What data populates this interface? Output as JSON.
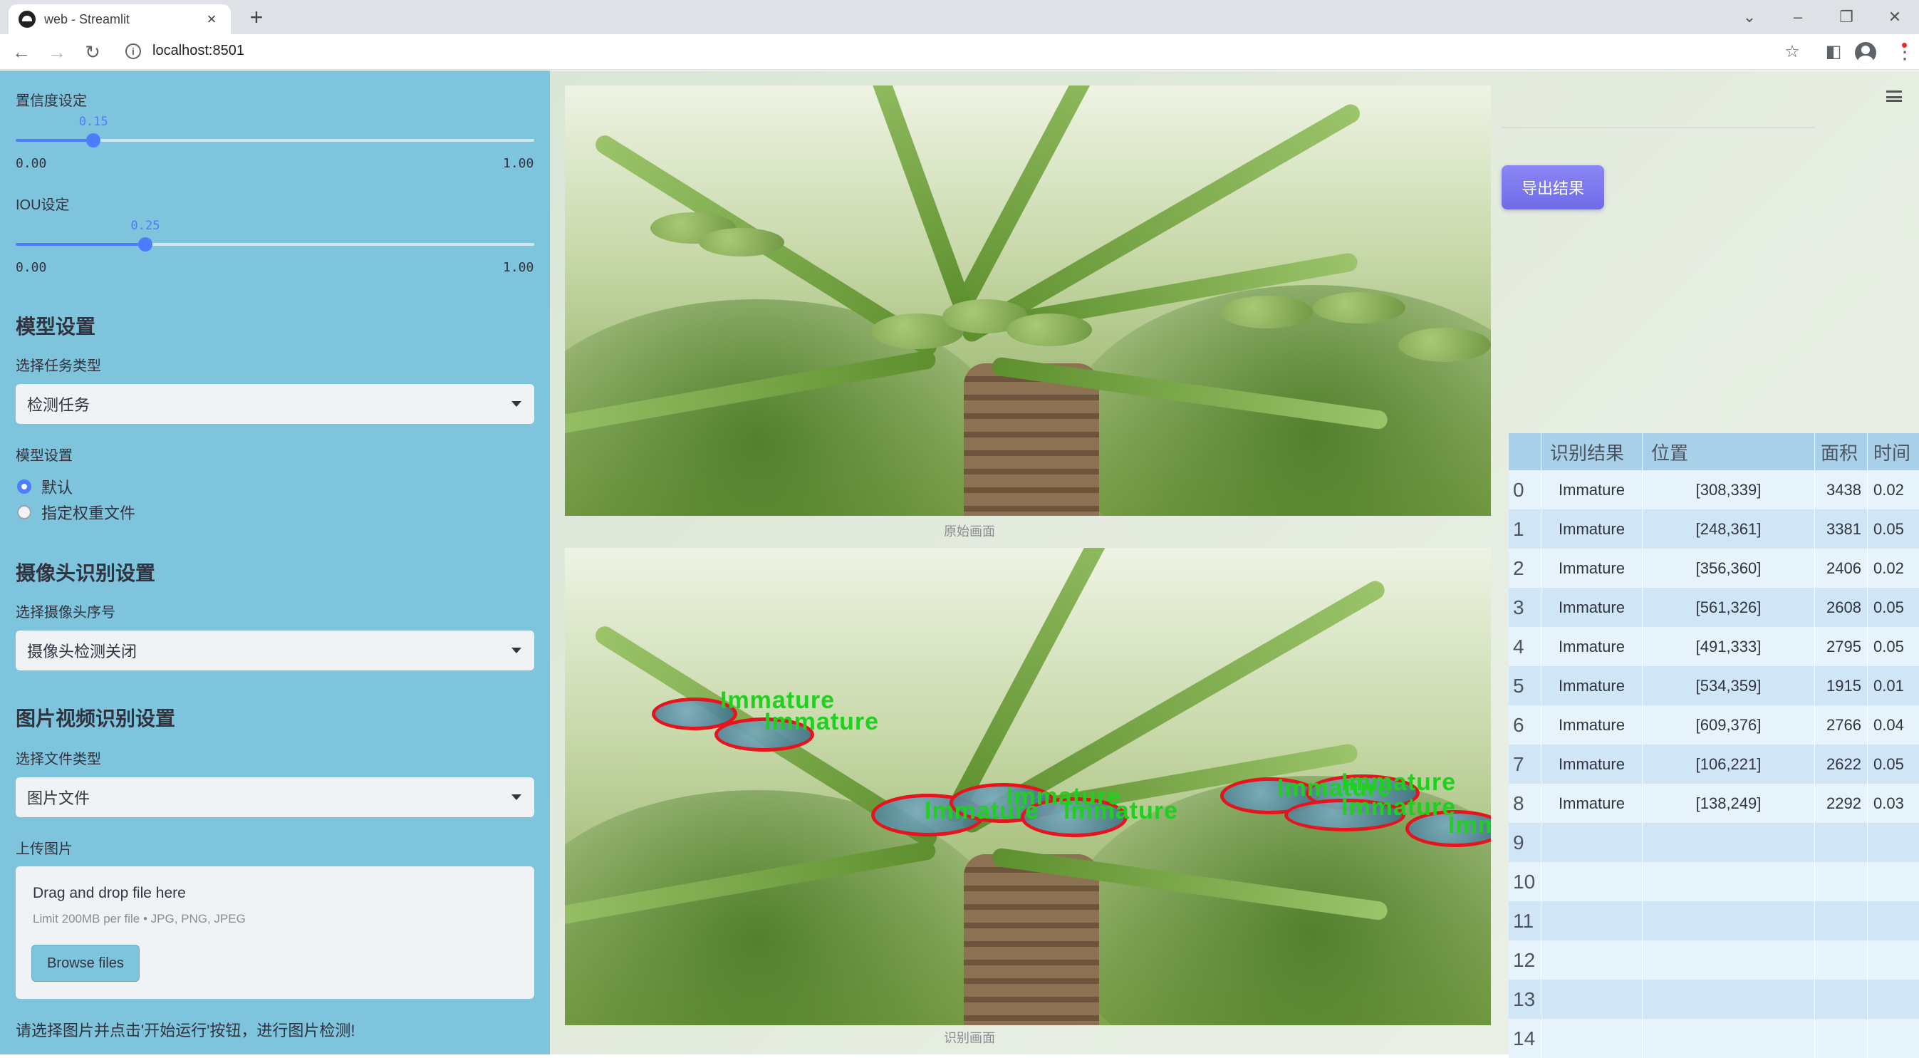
{
  "browser": {
    "tab_title": "web - Streamlit",
    "url": "localhost:8501"
  },
  "sidebar": {
    "conf_label": "置信度设定",
    "conf": {
      "value": "0.15",
      "min": "0.00",
      "max": "1.00",
      "fraction": 0.15
    },
    "iou_label": "IOU设定",
    "iou": {
      "value": "0.25",
      "min": "0.00",
      "max": "1.00",
      "fraction": 0.25
    },
    "model_heading": "模型设置",
    "task_type_label": "选择任务类型",
    "task_type_value": "检测任务",
    "model_label": "模型设置",
    "model_options": [
      "默认",
      "指定权重文件"
    ],
    "model_selected": 0,
    "camera_heading": "摄像头识别设置",
    "camera_label": "选择摄像头序号",
    "camera_value": "摄像头检测关闭",
    "media_heading": "图片视频识别设置",
    "file_type_label": "选择文件类型",
    "file_type_value": "图片文件",
    "upload_label": "上传图片",
    "upload": {
      "title": "Drag and drop file here",
      "limit": "Limit 200MB per file • JPG, PNG, JPEG",
      "button": "Browse files"
    },
    "info_text": "请选择图片并点击'开始运行'按钮，进行图片检测!"
  },
  "main": {
    "export_button": "导出结果",
    "original_caption": "原始画面",
    "result_caption": "识别画面",
    "detection_label": "Immature",
    "table": {
      "headers": [
        "",
        "识别结果",
        "位置",
        "面积",
        "时间"
      ],
      "rows": [
        [
          "0",
          "Immature",
          "[308,339]",
          "3438",
          "0.02"
        ],
        [
          "1",
          "Immature",
          "[248,361]",
          "3381",
          "0.05"
        ],
        [
          "2",
          "Immature",
          "[356,360]",
          "2406",
          "0.02"
        ],
        [
          "3",
          "Immature",
          "[561,326]",
          "2608",
          "0.05"
        ],
        [
          "4",
          "Immature",
          "[491,333]",
          "2795",
          "0.05"
        ],
        [
          "5",
          "Immature",
          "[534,359]",
          "1915",
          "0.01"
        ],
        [
          "6",
          "Immature",
          "[609,376]",
          "2766",
          "0.04"
        ],
        [
          "7",
          "Immature",
          "[106,221]",
          "2622",
          "0.05"
        ],
        [
          "8",
          "Immature",
          "[138,249]",
          "2292",
          "0.03"
        ],
        [
          "9",
          "",
          "",
          "",
          ""
        ],
        [
          "10",
          "",
          "",
          "",
          ""
        ],
        [
          "11",
          "",
          "",
          "",
          ""
        ],
        [
          "12",
          "",
          "",
          "",
          ""
        ],
        [
          "13",
          "",
          "",
          "",
          ""
        ],
        [
          "14",
          "",
          "",
          "",
          ""
        ]
      ]
    }
  }
}
